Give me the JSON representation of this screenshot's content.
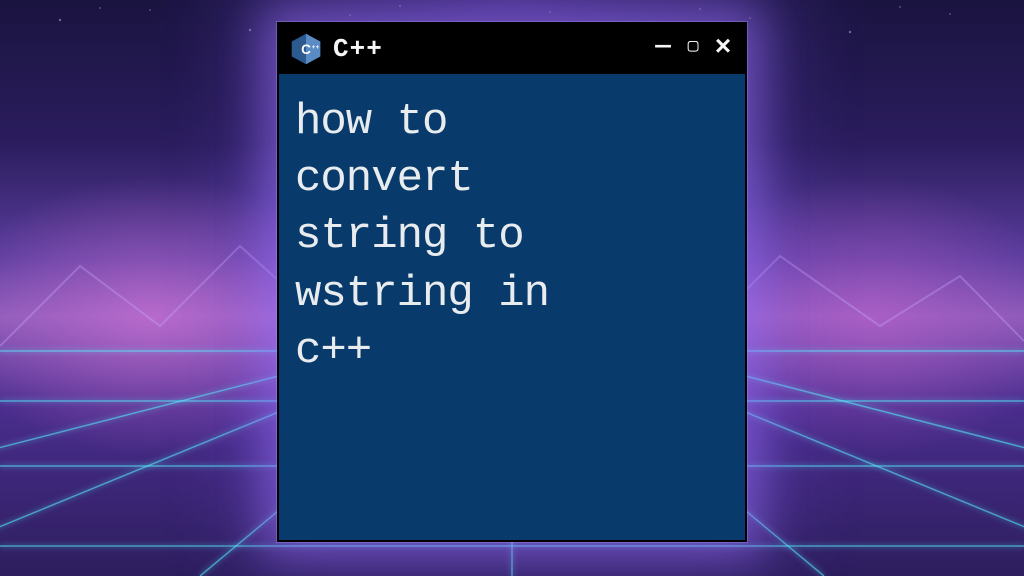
{
  "window": {
    "title": "C++",
    "icon_name": "cpp-icon",
    "icon_text": "C++",
    "content_text": "how to\nconvert\nstring to\nwstring in\nc++"
  },
  "colors": {
    "titlebar_bg": "#000000",
    "content_bg": "#083a6b",
    "text": "#e8ecee",
    "icon_fill": "#5a8bc4",
    "icon_dark": "#2c5a8e",
    "glow": "#a078ff",
    "grid": "#55f0ff"
  }
}
